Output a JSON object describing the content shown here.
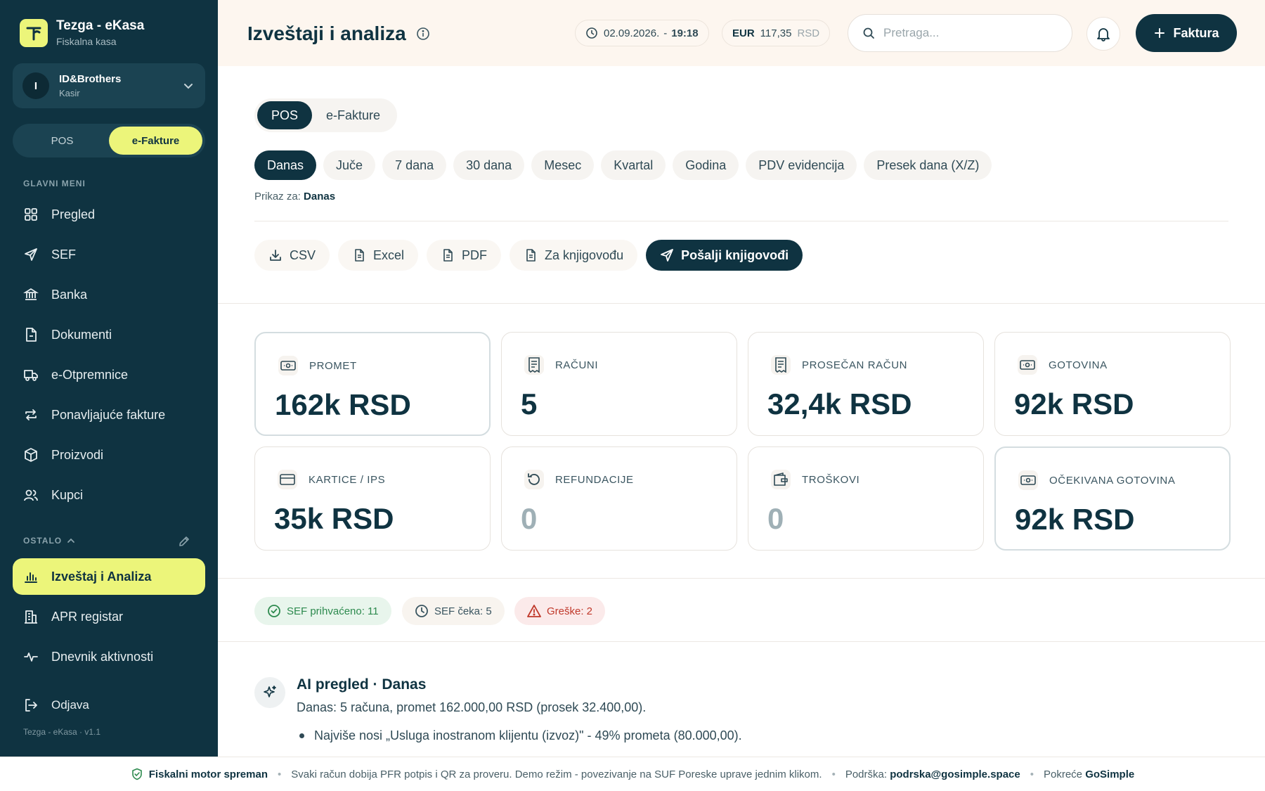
{
  "brand": {
    "title": "Tezga - eKasa",
    "subtitle": "Fiskalna kasa"
  },
  "user": {
    "initial": "I",
    "name": "ID&Brothers",
    "role": "Kasir"
  },
  "mode_toggle": [
    {
      "label": "POS",
      "active": false
    },
    {
      "label": "e-Fakture",
      "active": true
    }
  ],
  "nav": {
    "main_label": "GLAVNI MENI",
    "main_items": [
      {
        "label": "Pregled",
        "icon": "grid-icon"
      },
      {
        "label": "SEF",
        "icon": "send-icon"
      },
      {
        "label": "Banka",
        "icon": "bank-icon"
      },
      {
        "label": "Dokumenti",
        "icon": "document-icon"
      },
      {
        "label": "e-Otpremnice",
        "icon": "truck-icon"
      },
      {
        "label": "Ponavljajuće fakture",
        "icon": "repeat-icon"
      },
      {
        "label": "Proizvodi",
        "icon": "box-icon"
      },
      {
        "label": "Kupci",
        "icon": "users-icon"
      }
    ],
    "other_label": "OSTALO",
    "other_items": [
      {
        "label": "Izveštaj i Analiza",
        "icon": "bar-chart-icon",
        "active": true
      },
      {
        "label": "APR registar",
        "icon": "building-icon"
      },
      {
        "label": "Dnevnik aktivnosti",
        "icon": "activity-icon"
      }
    ],
    "logout": "Odjava",
    "version": "Tezga - eKasa · v1.1"
  },
  "header": {
    "title": "Izveštaji i analiza",
    "date": "02.09.2026.",
    "time": "19:18",
    "currency_code": "EUR",
    "currency_rate": "117,35",
    "currency_unit": "RSD",
    "search_placeholder": "Pretraga...",
    "primary_button": "Faktura"
  },
  "segment": [
    {
      "label": "POS",
      "active": true
    },
    {
      "label": "e-Fakture",
      "active": false
    }
  ],
  "periods": [
    {
      "label": "Danas",
      "active": true
    },
    {
      "label": "Juče"
    },
    {
      "label": "7 dana"
    },
    {
      "label": "30 dana"
    },
    {
      "label": "Mesec"
    },
    {
      "label": "Kvartal"
    },
    {
      "label": "Godina"
    },
    {
      "label": "PDV evidencija"
    },
    {
      "label": "Presek dana (X/Z)"
    }
  ],
  "showing": {
    "prefix": "Prikaz za:",
    "value": "Danas"
  },
  "exports": [
    {
      "label": "CSV",
      "icon": "download-icon"
    },
    {
      "label": "Excel",
      "icon": "file-icon"
    },
    {
      "label": "PDF",
      "icon": "file-icon"
    },
    {
      "label": "Za knjigovođu",
      "icon": "file-icon"
    },
    {
      "label": "Pošalji knjigovođi",
      "icon": "send-icon",
      "primary": true
    }
  ],
  "stats": [
    {
      "label": "PROMET",
      "value": "162k RSD",
      "icon": "cash-icon"
    },
    {
      "label": "RAČUNI",
      "value": "5",
      "icon": "receipt-icon"
    },
    {
      "label": "PROSEČAN RAČUN",
      "value": "32,4k RSD",
      "icon": "receipt-icon"
    },
    {
      "label": "GOTOVINA",
      "value": "92k RSD",
      "icon": "cash-icon"
    },
    {
      "label": "KARTICE / IPS",
      "value": "35k RSD",
      "icon": "card-icon"
    },
    {
      "label": "REFUNDACIJE",
      "value": "0",
      "icon": "undo-icon"
    },
    {
      "label": "TROŠKOVI",
      "value": "0",
      "icon": "wallet-icon"
    },
    {
      "label": "OČEKIVANA GOTOVINA",
      "value": "92k RSD",
      "icon": "cash-icon"
    }
  ],
  "sef_status": {
    "accepted": "SEF prihvaćeno: 11",
    "waiting": "SEF čeka: 5",
    "errors": "Greške: 2"
  },
  "ai": {
    "title": "AI pregled · Danas",
    "summary": "Danas: 5 računa, promet 162.000,00 RSD (prosek 32.400,00).",
    "bullets": [
      "Najviše nosi „Usluga inostranom klijentu (izvoz)\" - 49% prometa (80.000,00)."
    ]
  },
  "footer": {
    "status": "Fiskalni motor spreman",
    "info": "Svaki račun dobija PFR potpis i QR za proveru. Demo režim - povezivanje na SUF Poreske uprave jednim klikom.",
    "support_label": "Podrška:",
    "support_email": "podrska@gosimple.space",
    "powered_label": "Pokreće",
    "powered_by": "GoSimple"
  },
  "colors": {
    "sidebar": "#0f3341",
    "accent": "#ecf57a",
    "header_bg": "#fdf6ef",
    "ok": "#2d8a4e",
    "error": "#c0392b"
  }
}
